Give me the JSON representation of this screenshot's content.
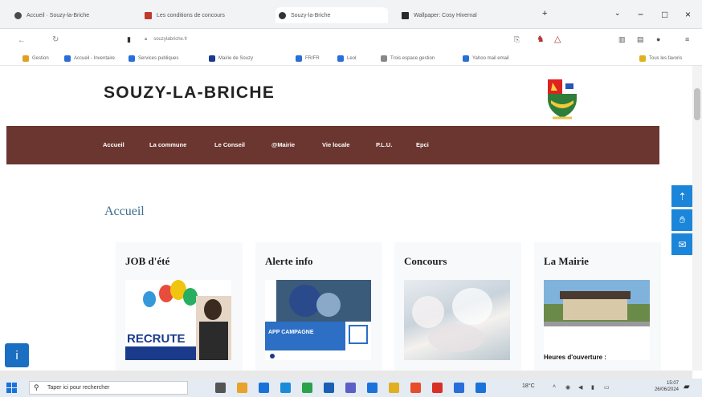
{
  "browser": {
    "tabs": [
      {
        "title": "Accueil · Souzy-la-Briche",
        "fav": "#4a4a4a"
      },
      {
        "title": "Les conditions de concours",
        "fav": "#c0392b"
      },
      {
        "title": "Souzy-la-Briche",
        "fav": "#333333"
      },
      {
        "title": "Wallpaper: Cosy Hivernal",
        "fav": "#2a2a2a"
      }
    ],
    "url": "souzylabriche.fr",
    "bookmarks": [
      "Gestion",
      "Accueil - Inventaire",
      "Services publiques",
      "Mairie de Souzy",
      "FR/FR",
      "Leol",
      "Trois espace gestion",
      "Yahoo mail email"
    ],
    "bookmarks_other": "Tous les favoris",
    "window": {
      "min": "−",
      "max": "□",
      "close": "×"
    }
  },
  "site": {
    "title": "SOUZY-LA-BRICHE",
    "nav": [
      "Accueil",
      "La commune",
      "Le Conseil",
      "@Mairie",
      "Vie locale",
      "P.L.U.",
      "Epci"
    ],
    "breadcrumb": "Accueil",
    "cards": [
      {
        "title": "JOB d'été",
        "caption": "RECRUTE"
      },
      {
        "title": "Alerte info",
        "caption": "APP CAMPAGNE"
      },
      {
        "title": "Concours",
        "caption": ""
      },
      {
        "title": "La Mairie",
        "caption": "Heures d'ouverture :"
      }
    ],
    "accent": "#6b3630",
    "link_color": "#3f6d8c",
    "side_icons": [
      "tree-icon",
      "thumbs-up-icon",
      "mail-icon"
    ]
  },
  "taskbar": {
    "search_placeholder": "Taper ici pour rechercher",
    "weather": "18°C",
    "time": "15:07",
    "date": "26/06/2024"
  }
}
